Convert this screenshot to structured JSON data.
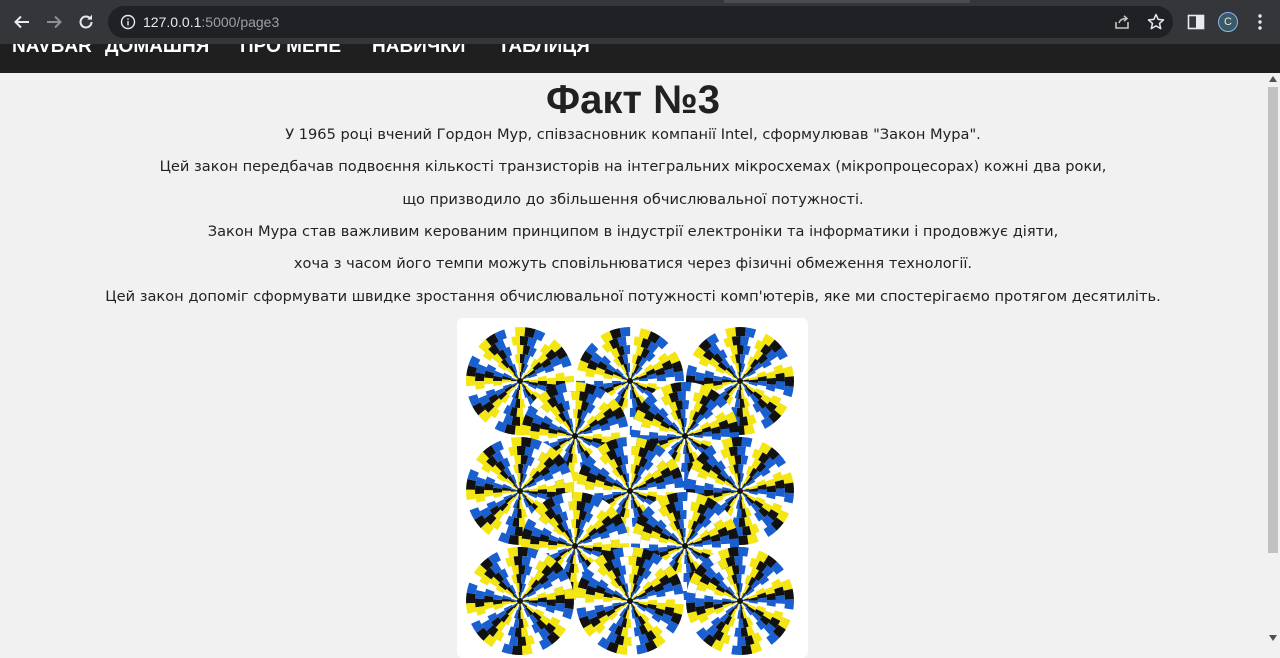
{
  "browser": {
    "url_host": "127.0.0.1",
    "url_path": ":5000/page3",
    "profile_initial": "C",
    "icons": [
      "back-arrow-icon",
      "forward-arrow-icon",
      "reload-icon",
      "info-icon",
      "share-icon",
      "star-icon",
      "side-panel-icon",
      "more-menu-icon"
    ]
  },
  "navbar": {
    "brand": "NAVBAR",
    "items": [
      "ДОМАШНЯ",
      "ПРО МЕНЕ",
      "НАВИЧКИ",
      "ТАБЛИЦЯ"
    ]
  },
  "page": {
    "title": "Факт №3",
    "paragraphs": [
      "У 1965 році вчений Гордон Мур, співзасновник компанії Intel, сформулював \"Закон Мура\".",
      "Цей закон передбачав подвоєння кількості транзисторів на інтегральних мікросхемах (мікропроцесорах) кожні два роки,",
      "що призводило до збільшення обчислювальної потужності.",
      "Закон Мура став важливим керованим принципом в індустрії електроніки та інформатики і продовжує діяти,",
      "хоча з часом його темпи можуть сповільнюватися через фізичні обмеження технології.",
      "Цей закон допоміг сформувати швидке зростання обчислювальної потужності комп'ютерів, яке ми спостерігаємо протягом десятиліть."
    ],
    "image": {
      "subject": "rotating-snakes-optical-illusion",
      "colors": [
        "#1a5fd0",
        "#f3e612",
        "#111111",
        "#ffffff"
      ]
    }
  },
  "colors": {
    "chrome_bg": "#35363a",
    "omnibox_bg": "#202124",
    "navbar_bg": "#1f1f1f",
    "page_bg": "#f1f1f1"
  }
}
